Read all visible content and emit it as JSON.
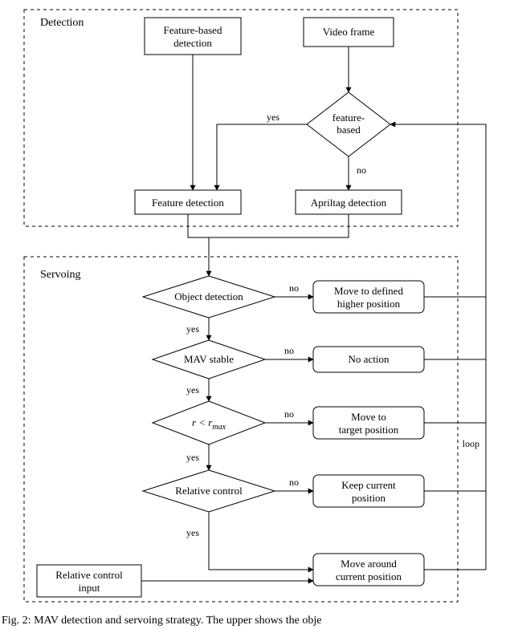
{
  "diagram": {
    "sections": {
      "detection": "Detection",
      "servoing": "Servoing"
    },
    "boxes": {
      "feature_based_detection_l1": "Feature-based",
      "feature_based_detection_l2": "detection",
      "video_frame": "Video frame",
      "feature_detection": "Feature detection",
      "apriltag_detection": "Apriltag detection",
      "relative_control_input_l1": "Relative control",
      "relative_control_input_l2": "input"
    },
    "diamonds": {
      "feature_based_l1": "feature-",
      "feature_based_l2": "based",
      "object_detection": "Object detection",
      "mav_stable": "MAV stable",
      "r_lt_rmax_l": "r < r",
      "r_lt_rmax_sub": "max",
      "relative_control": "Relative control"
    },
    "actions": {
      "higher_pos_l1": "Move to defined",
      "higher_pos_l2": "higher position",
      "no_action": "No action",
      "target_pos_l1": "Move to",
      "target_pos_l2": "target position",
      "keep_pos_l1": "Keep current",
      "keep_pos_l2": "position",
      "move_around_l1": "Move around",
      "move_around_l2": "current position"
    },
    "edges": {
      "yes": "yes",
      "no": "no",
      "loop": "loop"
    }
  },
  "caption": "Fig. 2: MAV detection and servoing strategy. The upper shows the obje"
}
